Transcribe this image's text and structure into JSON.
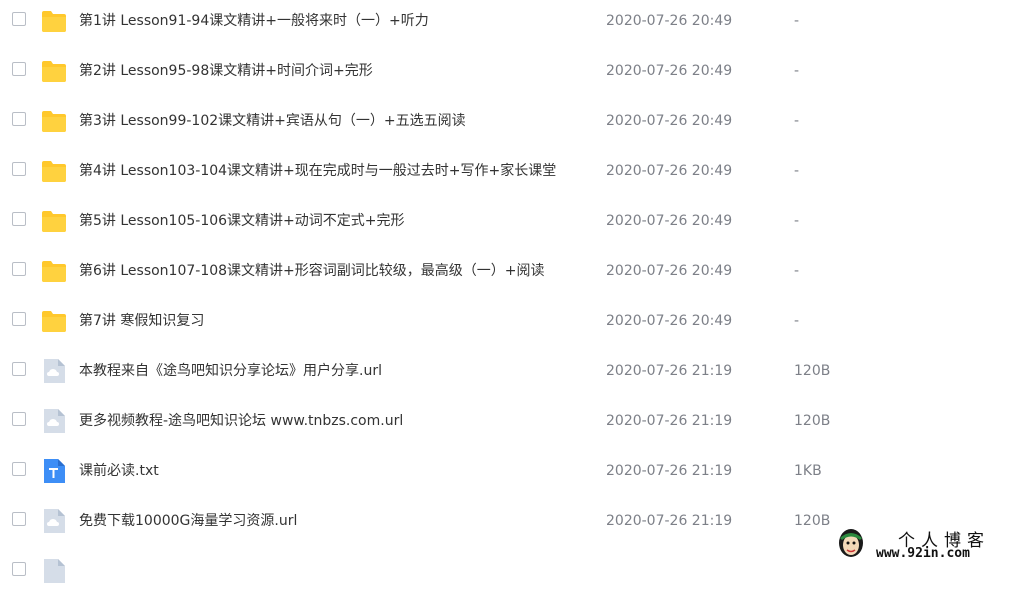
{
  "files": [
    {
      "icon": "folder-icon",
      "name": "第1讲 Lesson91-94课文精讲+一般将来时（一）+听力",
      "date": "2020-07-26 20:49",
      "size": "-"
    },
    {
      "icon": "folder-icon",
      "name": "第2讲 Lesson95-98课文精讲+时间介词+完形",
      "date": "2020-07-26 20:49",
      "size": "-"
    },
    {
      "icon": "folder-icon",
      "name": "第3讲 Lesson99-102课文精讲+宾语从句（一）+五选五阅读",
      "date": "2020-07-26 20:49",
      "size": "-"
    },
    {
      "icon": "folder-icon",
      "name": "第4讲 Lesson103-104课文精讲+现在完成时与一般过去时+写作+家长课堂",
      "date": "2020-07-26 20:49",
      "size": "-"
    },
    {
      "icon": "folder-icon",
      "name": "第5讲 Lesson105-106课文精讲+动词不定式+完形",
      "date": "2020-07-26 20:49",
      "size": "-"
    },
    {
      "icon": "folder-icon",
      "name": "第6讲 Lesson107-108课文精讲+形容词副词比较级，最高级（一）+阅读",
      "date": "2020-07-26 20:49",
      "size": "-"
    },
    {
      "icon": "folder-icon",
      "name": "第7讲 寒假知识复习",
      "date": "2020-07-26 20:49",
      "size": "-"
    },
    {
      "icon": "url-file-icon",
      "name": "本教程来自《途鸟吧知识分享论坛》用户分享.url",
      "date": "2020-07-26 21:19",
      "size": "120B"
    },
    {
      "icon": "url-file-icon",
      "name": "更多视频教程-途鸟吧知识论坛 www.tnbzs.com.url",
      "date": "2020-07-26 21:19",
      "size": "120B"
    },
    {
      "icon": "txt-file-icon",
      "name": "课前必读.txt",
      "date": "2020-07-26 21:19",
      "size": "1KB"
    },
    {
      "icon": "url-file-icon",
      "name": "免费下载10000G海量学习资源.url",
      "date": "2020-07-26 21:19",
      "size": "120B"
    },
    {
      "icon": "url-file-icon",
      "name": "",
      "date": "",
      "size": ""
    }
  ],
  "watermark": {
    "title": "个人博客",
    "url": "www.92in.com"
  },
  "colors": {
    "folder": "#ffc82c",
    "url_file": "#c8d3e0",
    "txt_file": "#3d8ef6"
  }
}
